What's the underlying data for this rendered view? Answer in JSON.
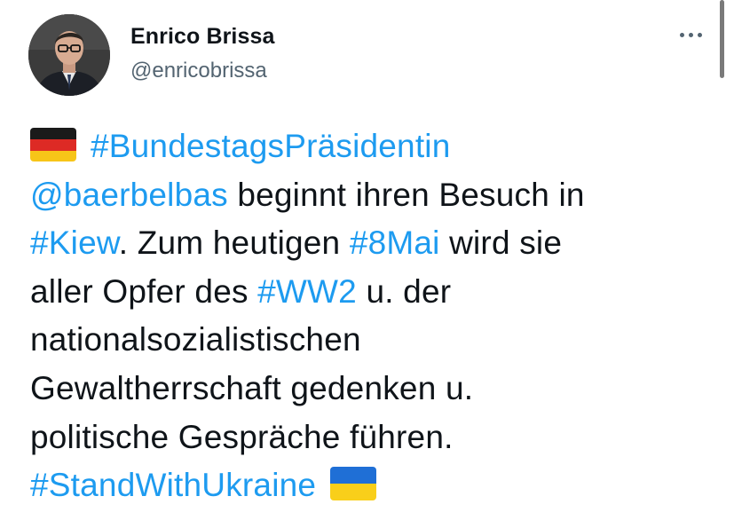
{
  "author": {
    "name": "Enrico Brissa",
    "handle": "@enricobrissa"
  },
  "icons": {
    "more": "more-options-icon",
    "flag_start": "germany-flag-icon",
    "flag_end": "ukraine-flag-icon"
  },
  "colors": {
    "link": "#1d9bf0",
    "text": "#0f1419",
    "secondary": "#536471"
  },
  "tweet": {
    "hashtag_bundestag": "#BundestagsPräsidentin",
    "mention_baerbelbas": "@baerbelbas",
    "text_1": " beginnt ihren Besuch in",
    "hashtag_kiew": "#Kiew",
    "text_2": ". Zum heutigen ",
    "hashtag_8mai": "#8Mai",
    "text_3": " wird sie",
    "text_4": "aller Opfer des ",
    "hashtag_ww2": "#WW2",
    "text_5": " u. der",
    "text_6": "nationalsozialistischen",
    "text_7": "Gewaltherrschaft gedenken u.",
    "text_8": "politische Gespräche führen.",
    "hashtag_standwithukraine": "#StandWithUkraine"
  }
}
